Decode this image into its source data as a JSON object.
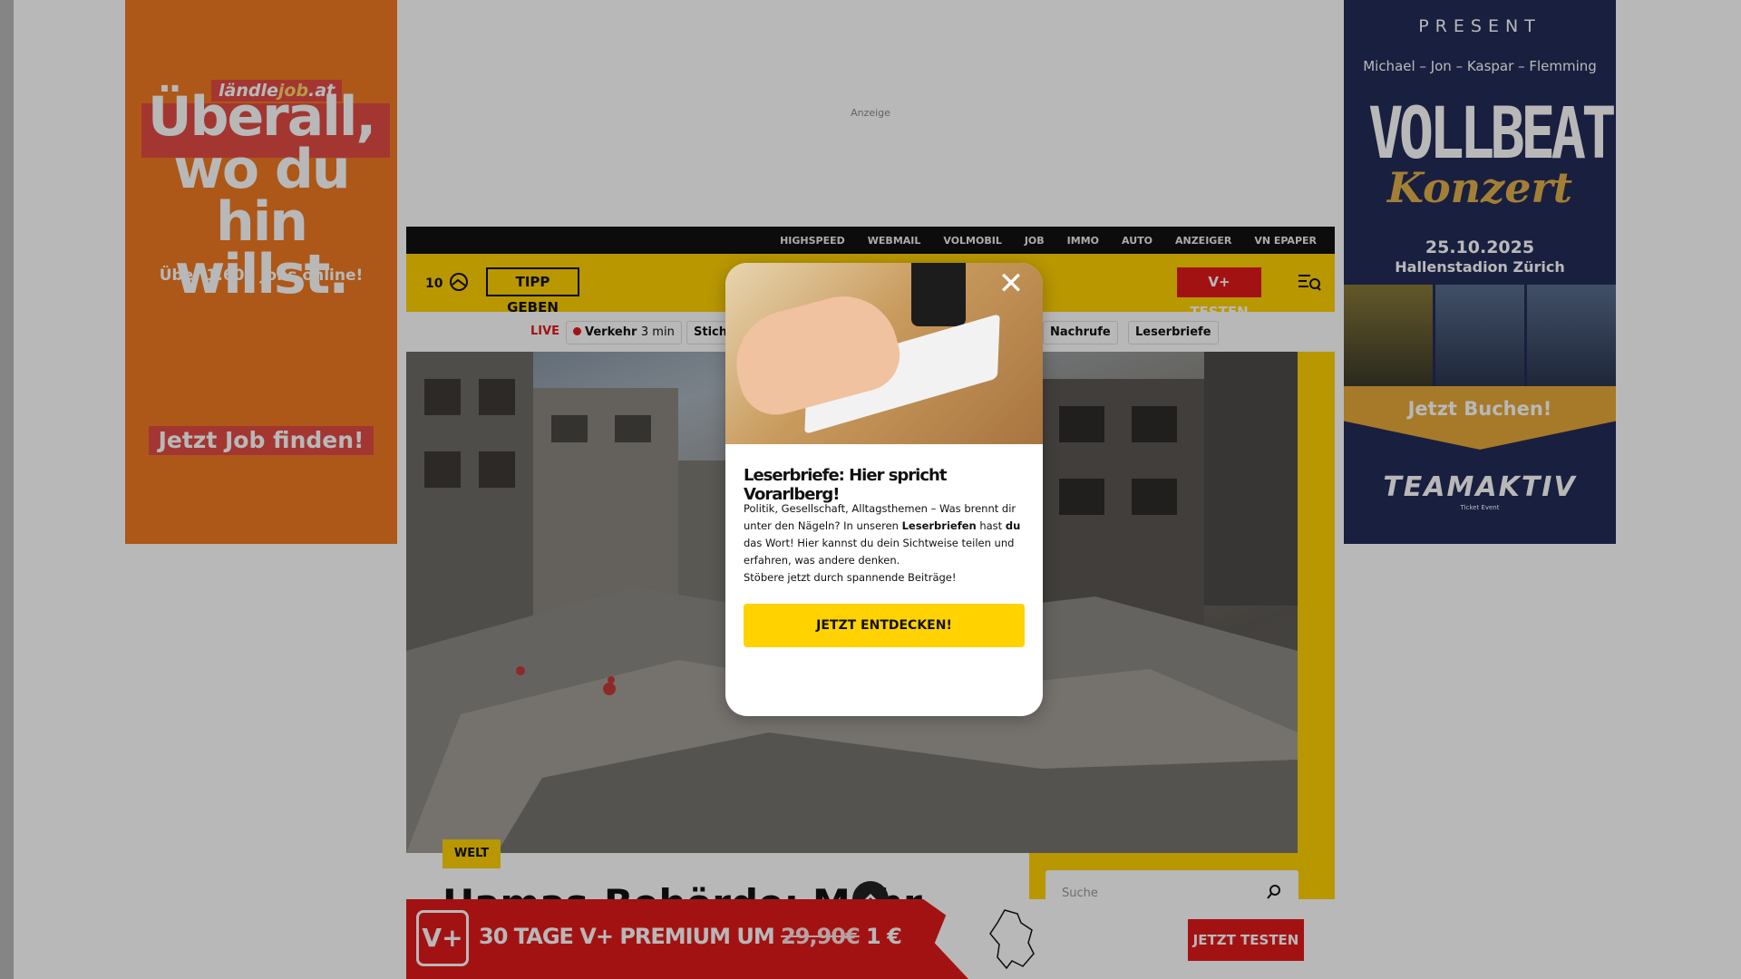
{
  "ads": {
    "left": {
      "brand_prefix": "ländle",
      "brand_job": "job",
      "brand_suffix": ".at",
      "headline_1": "Überall,",
      "headline_2": "wo du hin",
      "headline_3": "willst.",
      "subline": "Über 1.600 Jobs online!",
      "cta": "Jetzt Job finden!"
    },
    "top_label": "Anzeige",
    "right": {
      "present": "PRESENT",
      "names": "Michael – Jon – Kaspar – Flemming",
      "band": "VOLLBEAT",
      "event": "Konzert",
      "date": "25.10.2025",
      "venue": "Hallenstadion Zürich",
      "cta": "Jetzt Buchen!",
      "organizer": "TEAMAKTIV",
      "organizer_sub": "Ticket Event"
    }
  },
  "topbar": {
    "links": [
      "HIGHSPEED",
      "WEBMAIL",
      "VOLMOBIL",
      "JOB",
      "IMMO",
      "AUTO",
      "ANZEIGER",
      "VN EPAPER"
    ]
  },
  "header": {
    "temperature": "10",
    "tipp_label": "TIPP GEBEN",
    "vplus_label": "V+ TESTEN",
    "menu_icon": "menu-search-icon"
  },
  "subnav": {
    "live": "LIVE",
    "verkehr_label": "Verkehr",
    "verkehr_time": "3 min",
    "stich_label": "Stich",
    "nachrufe": "Nachrufe",
    "leserbriefe": "Leserbriefe"
  },
  "article": {
    "category": "WELT",
    "title": "Hamas-Behörde: Mehr"
  },
  "sidebar": {
    "search_placeholder": "Suche"
  },
  "banner": {
    "logo": "V+",
    "offer_prefix": "30 TAGE V+ PREMIUM UM",
    "old_price": "29,90€",
    "new_price": "1 €",
    "cta": "JETZT TESTEN"
  },
  "modal": {
    "close": "✕",
    "title": "Leserbriefe: Hier spricht Vorarlberg!",
    "text_1": "Politik, Gesellschaft, Alltagsthemen – Was brennt dir unter den Nägeln? In unseren ",
    "text_bold_1": "Leserbriefen",
    "text_2": " hast ",
    "text_bold_2": "du",
    "text_3": " das Wort! Hier kannst du dein Sichtweise teilen und erfahren, was andere denken.",
    "text_4": "Stöbere jetzt durch spannende Beiträge!",
    "button": "JETZT ENTDECKEN!"
  },
  "colors": {
    "brand_yellow": "#ffd200",
    "brand_red": "#e2191b",
    "ad_orange": "#f07a22",
    "ad_navy": "#232c58"
  }
}
